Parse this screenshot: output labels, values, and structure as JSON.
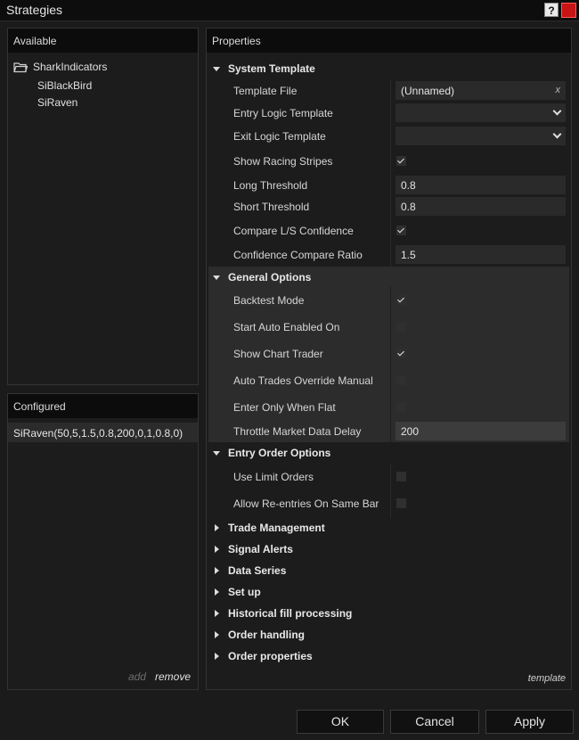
{
  "window": {
    "title": "Strategies",
    "help": "?"
  },
  "available": {
    "header": "Available",
    "folder": "SharkIndicators",
    "items": [
      "SiBlackBird",
      "SiRaven"
    ]
  },
  "configured": {
    "header": "Configured",
    "items": [
      "SiRaven(50,5,1.5,0.8,200,0,1,0.8,0)"
    ],
    "add": "add",
    "remove": "remove"
  },
  "properties": {
    "header": "Properties",
    "system_template": {
      "title": "System Template",
      "template_file": {
        "label": "Template File",
        "value": "(Unnamed)",
        "clear": "x"
      },
      "entry_logic": {
        "label": "Entry Logic Template",
        "value": ""
      },
      "exit_logic": {
        "label": "Exit Logic Template",
        "value": ""
      },
      "racing_stripes": {
        "label": "Show Racing Stripes",
        "checked": true
      },
      "long_threshold": {
        "label": "Long Threshold",
        "value": "0.8"
      },
      "short_threshold": {
        "label": "Short Threshold",
        "value": "0.8"
      },
      "compare_ls": {
        "label": "Compare L/S Confidence",
        "checked": true
      },
      "ratio": {
        "label": "Confidence Compare Ratio",
        "value": "1.5"
      }
    },
    "general_options": {
      "title": "General Options",
      "backtest": {
        "label": "Backtest Mode",
        "checked": true
      },
      "start_auto": {
        "label": "Start Auto Enabled On",
        "checked": false
      },
      "chart_trader": {
        "label": "Show Chart Trader",
        "checked": true
      },
      "auto_override": {
        "label": "Auto Trades Override Manual",
        "checked": false
      },
      "enter_flat": {
        "label": "Enter Only When Flat",
        "checked": false
      },
      "throttle": {
        "label": "Throttle Market Data Delay",
        "value": "200"
      }
    },
    "entry_order_options": {
      "title": "Entry Order Options",
      "limit_orders": {
        "label": "Use Limit Orders",
        "checked": false
      },
      "reentries": {
        "label": "Allow Re-entries On Same Bar",
        "checked": false
      }
    },
    "collapsed": [
      "Trade Management",
      "Signal Alerts",
      "Data Series",
      "Set up",
      "Historical fill processing",
      "Order handling",
      "Order properties"
    ],
    "template_link": "template"
  },
  "buttons": {
    "ok": "OK",
    "cancel": "Cancel",
    "apply": "Apply"
  }
}
